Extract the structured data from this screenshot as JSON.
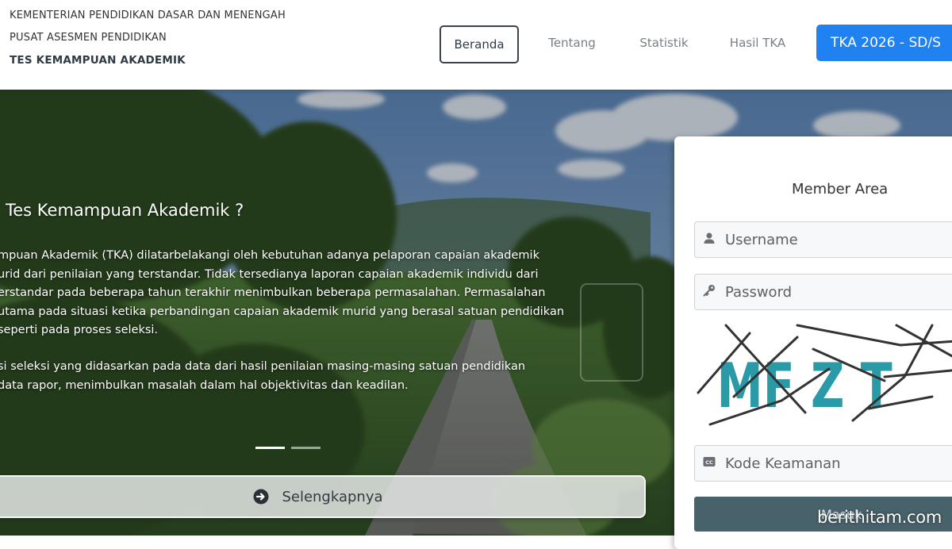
{
  "header": {
    "org_line1": "KEMENTERIAN PENDIDIKAN DASAR DAN MENENGAH",
    "org_line2": "PUSAT ASESMEN PENDIDIKAN",
    "org_line3": "TES KEMAMPUAN AKADEMIK",
    "nav": {
      "beranda": "Beranda",
      "tentang": "Tentang",
      "statistik": "Statistik",
      "hasil": "Hasil TKA",
      "primary": "TKA 2026 - SD/S"
    }
  },
  "hero": {
    "title": "Tes Kemampuan Akademik ?",
    "para1": [
      "mpuan Akademik (TKA) dilatarbelakangi oleh kebutuhan adanya pelaporan capaian akademik",
      "urid dari penilaian yang terstandar. Tidak tersedianya laporan capaian akademik individu dari",
      "erstandar pada beberapa tahun terakhir menimbulkan beberapa permasalahan. Permasalahan",
      "utama pada situasi ketika perbandingan capaian akademik murid yang berasal satuan pendidikan",
      "seperti pada proses seleksi."
    ],
    "para2": [
      "si seleksi yang didasarkan pada data dari hasil penilaian masing-masing satuan pendidikan",
      "data rapor, menimbulkan masalah dalam hal objektivitas dan keadilan."
    ],
    "more_label": "Selengkapnya",
    "slides": {
      "total": 2,
      "active": 1
    }
  },
  "login": {
    "title": "Member Area",
    "username_placeholder": "Username",
    "password_placeholder": "Password",
    "captcha_text": "MF Z T",
    "security_placeholder": "Kode Keamanan",
    "submit_label": "Masuk"
  },
  "watermark": "berithitam.com",
  "colors": {
    "primary": "#1f82f0",
    "submit": "#48626b",
    "captcha": "#2a9aa6"
  }
}
